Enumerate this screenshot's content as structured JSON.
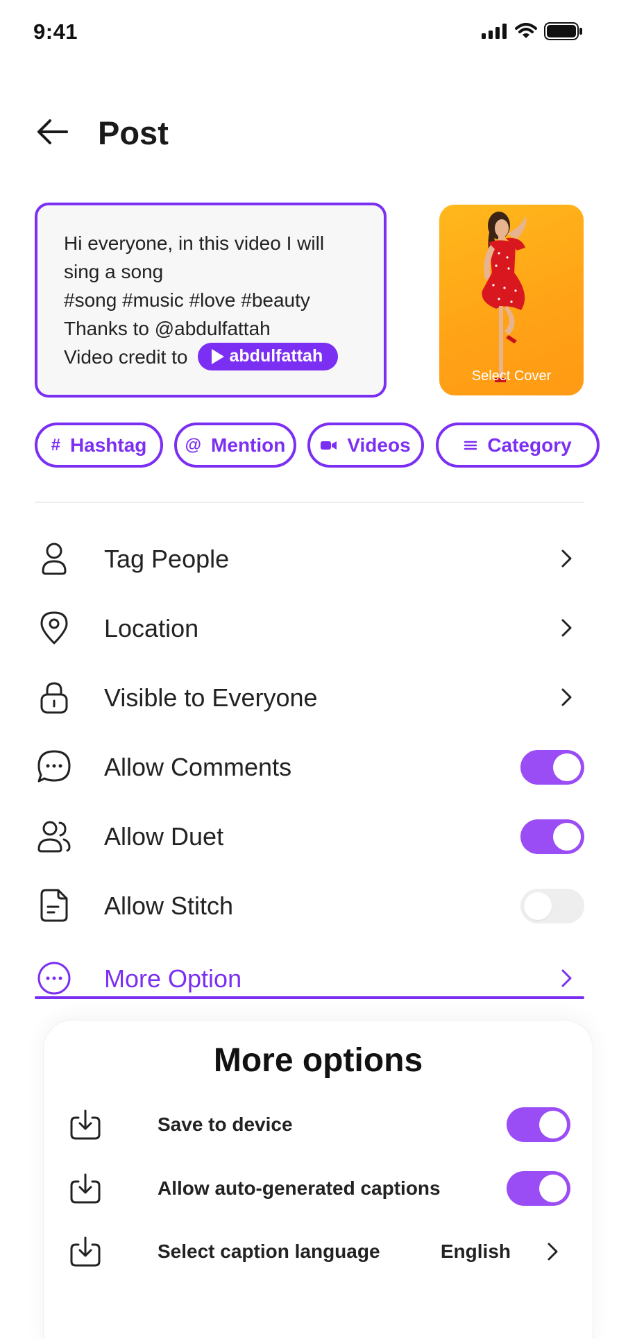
{
  "status_bar": {
    "time": "9:41"
  },
  "header": {
    "title": "Post"
  },
  "caption": {
    "lines": [
      "Hi everyone, in this video I will",
      "sing a song",
      "#song #music #love #beauty",
      "Thanks to @abdulfattah"
    ],
    "credit_prefix": "Video credit to",
    "credit_handle": "abdulfattah"
  },
  "cover": {
    "label": "Select Cover"
  },
  "chips": {
    "hashtag": "Hashtag",
    "mention": "Mention",
    "videos": "Videos",
    "category": "Category"
  },
  "settings": {
    "tag_people": "Tag People",
    "location": "Location",
    "visibility": "Visible to Everyone",
    "allow_comments": {
      "label": "Allow Comments",
      "on": true
    },
    "allow_duet": {
      "label": "Allow Duet",
      "on": true
    },
    "allow_stitch": {
      "label": "Allow Stitch",
      "on": false
    },
    "more_option": "More Option"
  },
  "sheet": {
    "title": "More options",
    "save_to_device": {
      "label": "Save to device",
      "on": true
    },
    "auto_captions": {
      "label": "Allow auto-generated captions",
      "on": true
    },
    "caption_language": {
      "label": "Select caption language",
      "value": "English"
    }
  },
  "colors": {
    "accent": "#7b2ff2",
    "toggle_on": "#9b4df5",
    "toggle_off": "#eeeeee",
    "cover_bg": "#ffa216"
  }
}
